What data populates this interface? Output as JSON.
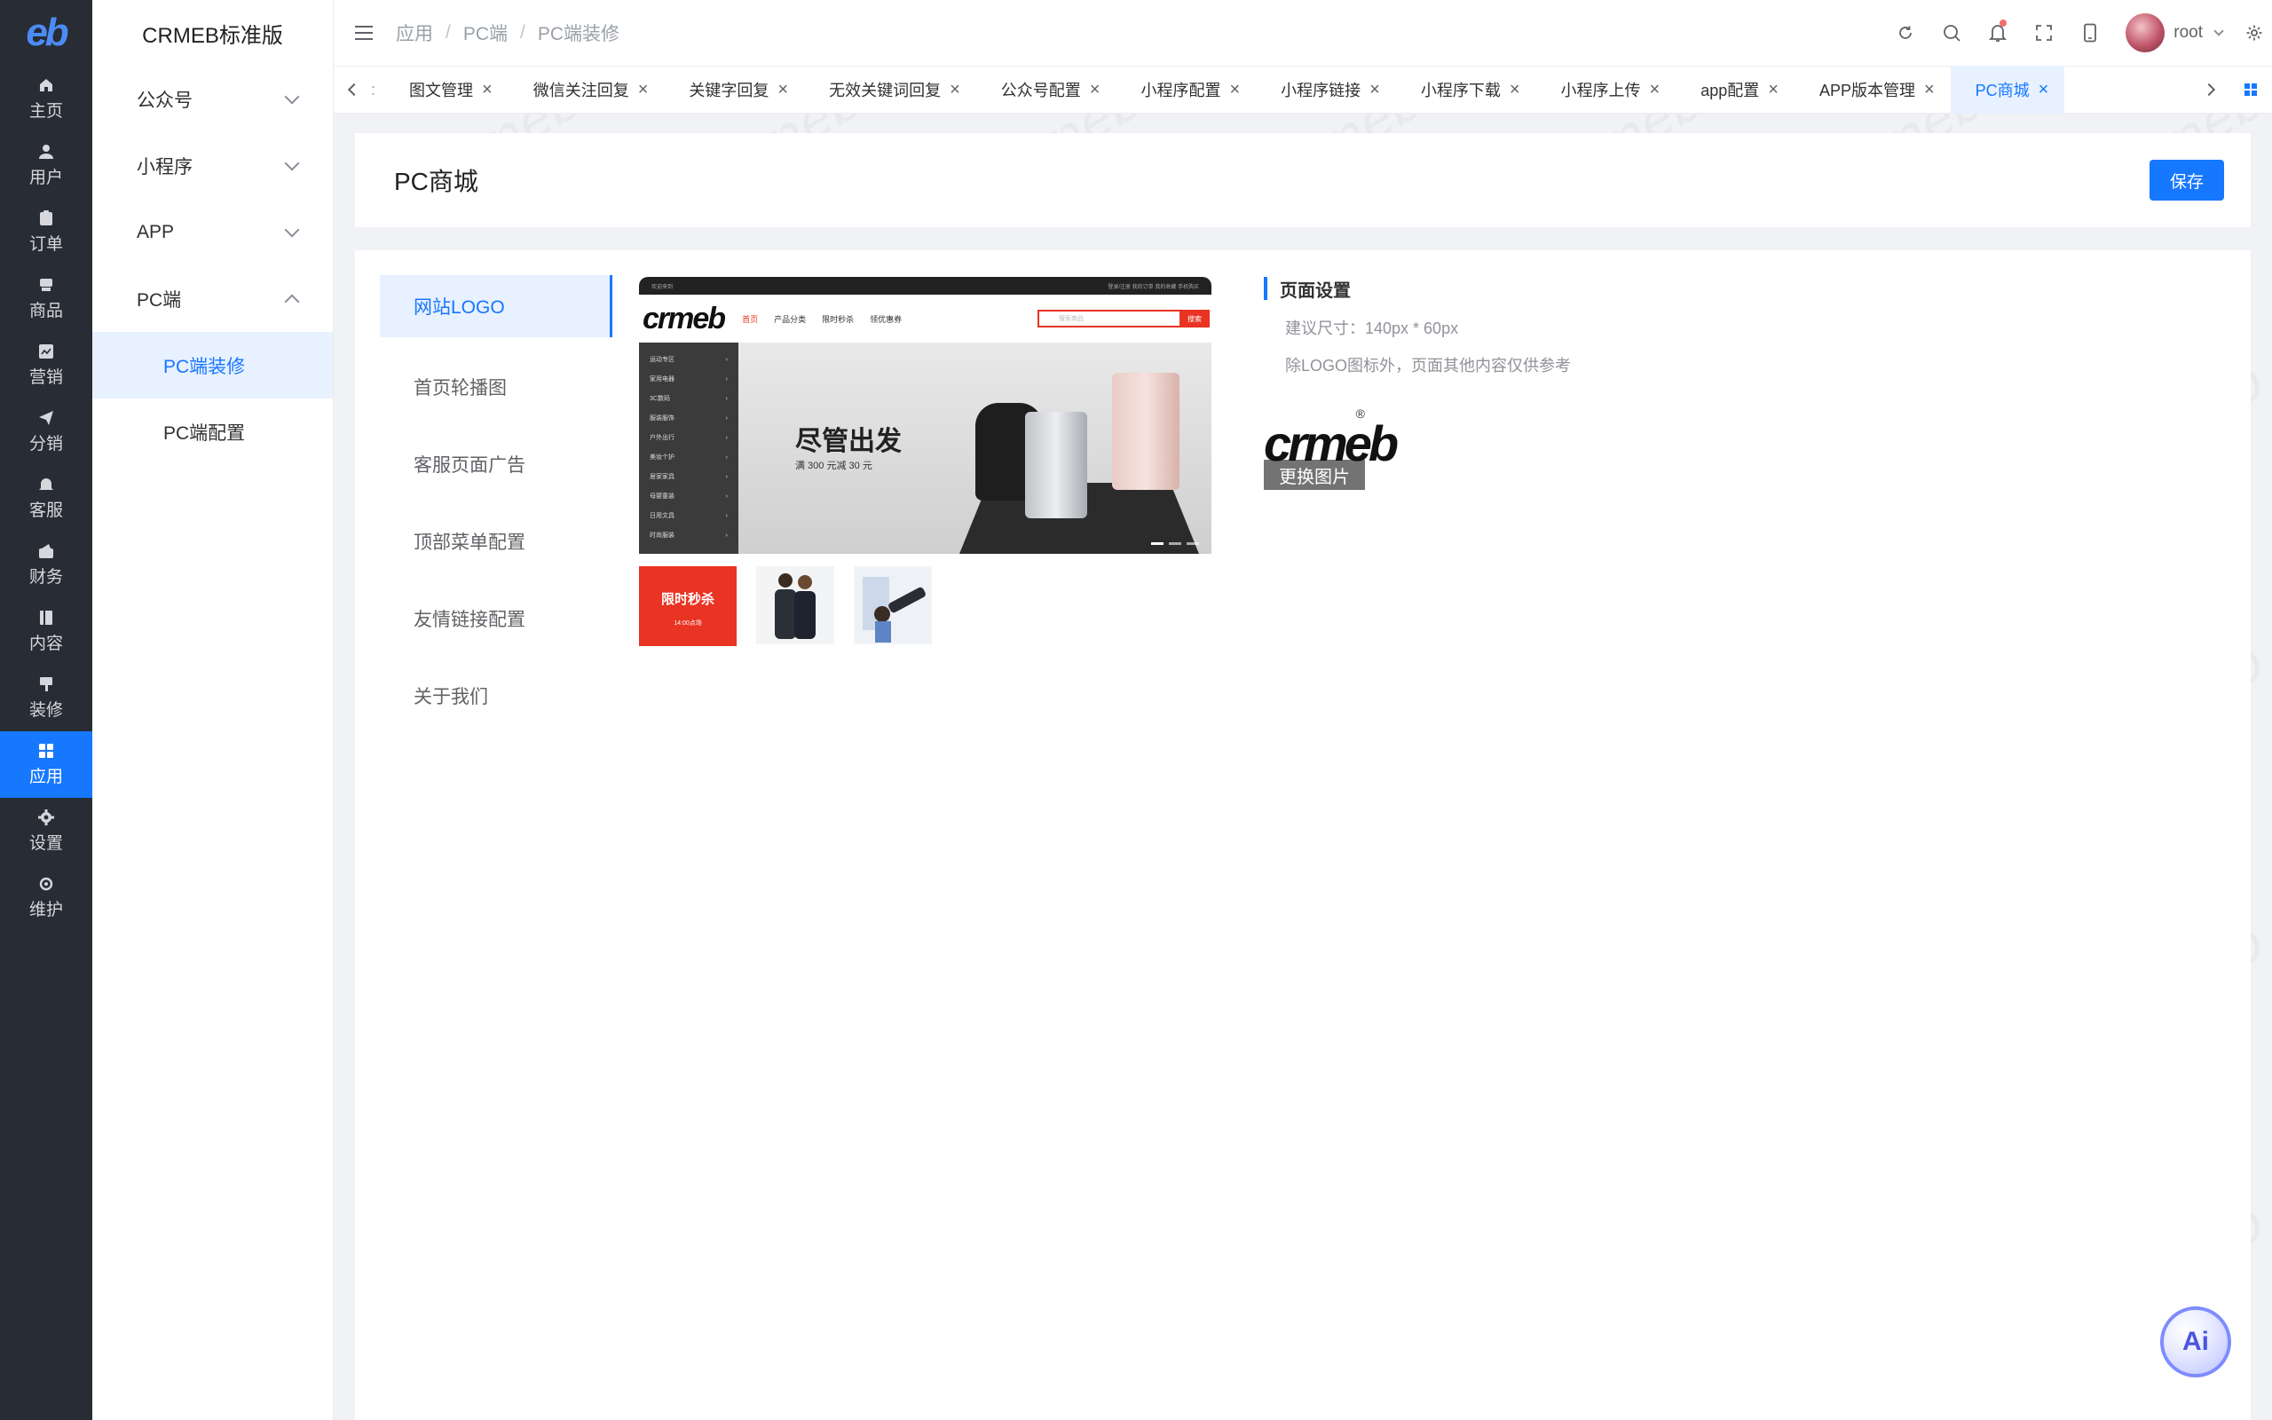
{
  "brand": {
    "logo_text": "eb",
    "app_name": "CRMEB标准版"
  },
  "rail": {
    "items": [
      {
        "label": "主页",
        "icon": "home-icon"
      },
      {
        "label": "用户",
        "icon": "user-icon"
      },
      {
        "label": "订单",
        "icon": "order-icon"
      },
      {
        "label": "商品",
        "icon": "product-icon"
      },
      {
        "label": "营销",
        "icon": "marketing-icon"
      },
      {
        "label": "分销",
        "icon": "distribution-icon"
      },
      {
        "label": "客服",
        "icon": "service-icon"
      },
      {
        "label": "财务",
        "icon": "finance-icon"
      },
      {
        "label": "内容",
        "icon": "content-icon"
      },
      {
        "label": "装修",
        "icon": "decorate-icon"
      },
      {
        "label": "应用",
        "icon": "apps-icon"
      },
      {
        "label": "设置",
        "icon": "settings-icon"
      },
      {
        "label": "维护",
        "icon": "maintenance-icon"
      }
    ],
    "active": "应用"
  },
  "sidebar": {
    "groups": [
      {
        "label": "公众号",
        "expanded": false
      },
      {
        "label": "小程序",
        "expanded": false
      },
      {
        "label": "APP",
        "expanded": false
      },
      {
        "label": "PC端",
        "expanded": true
      }
    ],
    "sub_items": [
      {
        "label": "PC端装修",
        "active": true
      },
      {
        "label": "PC端配置",
        "active": false
      }
    ]
  },
  "breadcrumb": [
    "应用",
    "PC端",
    "PC端装修"
  ],
  "user": {
    "name": "root"
  },
  "tabs": {
    "stub": ":",
    "items": [
      "图文管理",
      "微信关注回复",
      "关键字回复",
      "无效关键词回复",
      "公众号配置",
      "小程序配置",
      "小程序链接",
      "小程序下载",
      "小程序上传",
      "app配置",
      "APP版本管理",
      "PC商城"
    ],
    "active": "PC商城"
  },
  "page": {
    "title": "PC商城",
    "save_label": "保存"
  },
  "config_menu": {
    "items": [
      "网站LOGO",
      "首页轮播图",
      "客服页面广告",
      "顶部菜单配置",
      "友情链接配置",
      "关于我们"
    ],
    "active": "网站LOGO"
  },
  "preview": {
    "logo": "crmeb",
    "nav_links": [
      "首页",
      "产品分类",
      "限时秒杀",
      "领优惠券"
    ],
    "search_placeholder": "搜索商品",
    "search_button": "搜索",
    "top_left": "欢迎来到",
    "top_right": "登录/注册  我的订单  我的收藏  手机购买",
    "categories": [
      "运动专区",
      "家用电器",
      "3C数码",
      "服装服饰",
      "户外出行",
      "美妆个护",
      "居家家具",
      "母婴童装",
      "日用文具",
      "时尚服装"
    ],
    "banner_title": "尽管出发",
    "banner_sub": "满 300 元减 30 元",
    "seckill_title": "限时秒杀",
    "seckill_time": "14:00点场"
  },
  "settings": {
    "title": "页面设置",
    "size_tip": "建议尺寸：140px * 60px",
    "note": "除LOGO图标外，页面其他内容仅供参考",
    "logo_text": "crmeb",
    "replace_label": "更换图片"
  },
  "ai_button": {
    "label": "Ai"
  }
}
